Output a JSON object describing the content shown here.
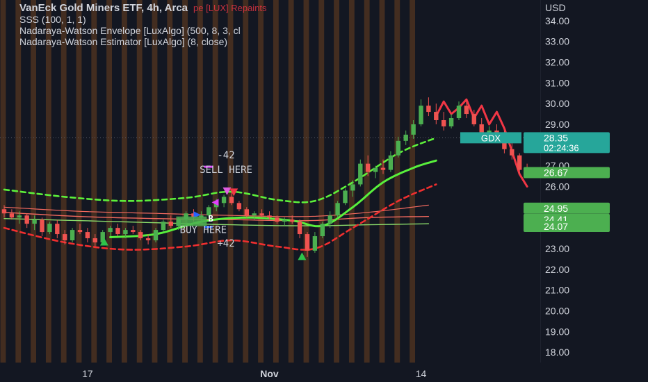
{
  "legend": {
    "title": "VanEck Gold Miners ETF, 4h, Arca",
    "title_suffix": "pe [LUX] Repaints",
    "lines": [
      "SSS (100, 1, 1)",
      "Nadaraya-Watson Envelope [LuxAlgo] (500, 8, 3, cl",
      "Nadaraya-Watson Estimator [LuxAlgo] (8, close)"
    ]
  },
  "colors": {
    "background": "#131722",
    "bar_stripe": "#6b3f1f",
    "up": "#4caf50",
    "down": "#ef5350",
    "envelope_upper": "#5df03a",
    "envelope_lower": "#f02f2f",
    "estimator": "#58f03c",
    "axis_text": "#d1d4dc",
    "price_label": "#26a69a",
    "level_label": "#4caf50"
  },
  "chart_data": {
    "type": "candlestick",
    "currency_label": "USD",
    "ylim": [
      17.5,
      35.0
    ],
    "y_ticks": [
      18,
      19,
      20,
      21,
      22,
      23,
      24,
      25,
      26,
      27,
      28,
      29,
      30,
      31,
      32,
      33,
      34
    ],
    "x_ticks": [
      "17",
      "Nov",
      "14"
    ],
    "ohlc": [
      [
        24.9,
        25.1,
        24.5,
        24.7
      ],
      [
        24.7,
        24.9,
        24.4,
        24.5
      ],
      [
        24.5,
        24.8,
        24.2,
        24.6
      ],
      [
        24.6,
        24.7,
        24.0,
        24.2
      ],
      [
        24.2,
        24.6,
        23.9,
        24.4
      ],
      [
        24.4,
        24.5,
        23.6,
        23.8
      ],
      [
        23.8,
        24.3,
        23.7,
        24.2
      ],
      [
        24.2,
        24.4,
        23.5,
        23.7
      ],
      [
        23.7,
        23.9,
        23.2,
        23.4
      ],
      [
        23.4,
        24.0,
        23.3,
        23.9
      ],
      [
        23.9,
        24.2,
        23.7,
        23.8
      ],
      [
        23.8,
        24.0,
        23.3,
        23.5
      ],
      [
        23.5,
        23.7,
        23.1,
        23.3
      ],
      [
        23.3,
        23.9,
        23.2,
        23.8
      ],
      [
        23.8,
        24.1,
        23.6,
        24.0
      ],
      [
        24.0,
        24.2,
        23.6,
        23.7
      ],
      [
        23.7,
        24.0,
        23.5,
        23.9
      ],
      [
        23.9,
        24.1,
        23.7,
        23.8
      ],
      [
        23.8,
        23.9,
        23.4,
        23.5
      ],
      [
        23.5,
        23.7,
        23.2,
        23.4
      ],
      [
        23.4,
        24.0,
        23.3,
        23.9
      ],
      [
        23.9,
        24.4,
        23.8,
        24.3
      ],
      [
        24.3,
        24.6,
        24.0,
        24.1
      ],
      [
        24.1,
        24.5,
        23.9,
        24.4
      ],
      [
        24.4,
        24.8,
        24.2,
        24.7
      ],
      [
        24.7,
        24.9,
        24.3,
        24.5
      ],
      [
        24.5,
        24.8,
        24.3,
        24.6
      ],
      [
        24.6,
        25.1,
        24.5,
        25.0
      ],
      [
        25.0,
        25.4,
        24.8,
        25.2
      ],
      [
        25.2,
        25.6,
        25.0,
        25.5
      ],
      [
        25.5,
        25.7,
        25.1,
        25.2
      ],
      [
        25.2,
        25.3,
        24.8,
        24.9
      ],
      [
        24.9,
        25.0,
        24.5,
        24.6
      ],
      [
        24.6,
        24.8,
        24.4,
        24.7
      ],
      [
        24.7,
        24.9,
        24.5,
        24.6
      ],
      [
        24.6,
        24.8,
        24.4,
        24.5
      ],
      [
        24.5,
        24.6,
        24.2,
        24.3
      ],
      [
        24.3,
        24.5,
        24.1,
        24.4
      ],
      [
        24.4,
        24.6,
        24.2,
        24.3
      ],
      [
        24.3,
        24.4,
        23.5,
        23.7
      ],
      [
        23.7,
        23.8,
        22.6,
        22.9
      ],
      [
        22.9,
        23.8,
        22.8,
        23.6
      ],
      [
        23.6,
        24.3,
        23.5,
        24.2
      ],
      [
        24.2,
        24.8,
        24.0,
        24.6
      ],
      [
        24.6,
        25.3,
        24.5,
        25.2
      ],
      [
        25.2,
        25.9,
        25.1,
        25.8
      ],
      [
        25.8,
        26.3,
        25.5,
        26.1
      ],
      [
        26.1,
        27.3,
        26.0,
        27.1
      ],
      [
        27.1,
        27.5,
        26.5,
        26.7
      ],
      [
        26.7,
        27.0,
        26.4,
        26.9
      ],
      [
        26.9,
        27.3,
        26.6,
        26.8
      ],
      [
        26.8,
        27.7,
        26.7,
        27.5
      ],
      [
        27.5,
        28.4,
        27.4,
        28.2
      ],
      [
        28.2,
        28.7,
        28.0,
        28.5
      ],
      [
        28.5,
        29.2,
        28.3,
        29.0
      ],
      [
        29.0,
        30.2,
        28.9,
        29.9
      ],
      [
        29.9,
        30.3,
        29.4,
        29.6
      ],
      [
        29.6,
        30.0,
        29.0,
        29.2
      ],
      [
        29.2,
        29.6,
        28.7,
        28.9
      ],
      [
        28.9,
        29.5,
        28.8,
        29.3
      ],
      [
        29.3,
        30.1,
        29.2,
        29.9
      ],
      [
        29.9,
        30.2,
        29.3,
        29.5
      ],
      [
        29.5,
        29.7,
        28.9,
        29.0
      ],
      [
        29.0,
        29.3,
        28.4,
        28.6
      ],
      [
        28.6,
        28.9,
        28.2,
        28.7
      ],
      [
        28.7,
        29.0,
        28.3,
        28.5
      ],
      [
        28.5,
        28.7,
        27.6,
        27.8
      ],
      [
        27.8,
        28.1,
        27.3,
        27.5
      ],
      [
        27.5,
        27.6,
        26.6,
        26.8
      ],
      [
        26.8,
        27.1,
        26.5,
        26.67
      ]
    ],
    "series": [
      {
        "name": "Nadaraya-Watson Envelope upper",
        "type": "dashed",
        "points": [
          [
            0,
            25.85
          ],
          [
            8,
            25.5
          ],
          [
            16,
            25.3
          ],
          [
            24,
            25.45
          ],
          [
            30,
            25.75
          ],
          [
            36,
            25.35
          ],
          [
            41,
            25.3
          ],
          [
            46,
            26.2
          ],
          [
            52,
            27.6
          ],
          [
            57,
            28.35
          ]
        ]
      },
      {
        "name": "Nadaraya-Watson Envelope lower",
        "type": "dashed",
        "points": [
          [
            0,
            24.0
          ],
          [
            8,
            23.3
          ],
          [
            16,
            22.95
          ],
          [
            24,
            23.1
          ],
          [
            30,
            23.4
          ],
          [
            36,
            23.1
          ],
          [
            41,
            23.0
          ],
          [
            46,
            24.0
          ],
          [
            52,
            25.3
          ],
          [
            57,
            26.1
          ]
        ]
      },
      {
        "name": "Nadaraya-Watson Estimator",
        "type": "solid",
        "points": [
          [
            14,
            23.55
          ],
          [
            20,
            23.7
          ],
          [
            26,
            24.3
          ],
          [
            32,
            24.5
          ],
          [
            38,
            24.35
          ],
          [
            42,
            24.1
          ],
          [
            46,
            25.0
          ],
          [
            50,
            26.2
          ],
          [
            54,
            26.9
          ],
          [
            57,
            27.25
          ]
        ]
      },
      {
        "name": "Nadaraya-Watson Estimator (repaint)",
        "type": "solid",
        "points": [
          [
            57,
            29.4
          ],
          [
            58,
            30.1
          ],
          [
            59,
            29.5
          ],
          [
            60,
            29.8
          ],
          [
            61,
            30.2
          ],
          [
            62,
            29.3
          ],
          [
            63,
            29.9
          ],
          [
            64,
            29.0
          ],
          [
            65,
            29.6
          ],
          [
            66,
            28.8
          ],
          [
            67,
            27.7
          ],
          [
            68,
            26.6
          ],
          [
            69,
            26.0
          ]
        ]
      },
      {
        "name": "SSS mid",
        "type": "solid",
        "points": [
          [
            0,
            24.75
          ],
          [
            10,
            24.55
          ],
          [
            20,
            24.45
          ],
          [
            30,
            24.4
          ],
          [
            40,
            24.35
          ],
          [
            48,
            24.5
          ],
          [
            56,
            24.55
          ]
        ]
      },
      {
        "name": "SSS low",
        "type": "solid",
        "points": [
          [
            0,
            24.45
          ],
          [
            10,
            24.35
          ],
          [
            20,
            24.25
          ],
          [
            30,
            24.15
          ],
          [
            40,
            24.1
          ],
          [
            48,
            24.15
          ],
          [
            56,
            24.2
          ]
        ]
      },
      {
        "name": "SSS high",
        "type": "solid",
        "points": [
          [
            0,
            25.0
          ],
          [
            10,
            24.8
          ],
          [
            20,
            24.7
          ],
          [
            30,
            24.6
          ],
          [
            40,
            24.55
          ],
          [
            48,
            24.75
          ],
          [
            56,
            25.1
          ]
        ]
      }
    ],
    "annotations": [
      {
        "text": "-42",
        "index": 30,
        "y": 27.35
      },
      {
        "text": "SELL HERE",
        "index": 30,
        "y": 26.65
      },
      {
        "text": "BUY HERE",
        "index": 27,
        "y": 23.75
      },
      {
        "text": "+42",
        "index": 30,
        "y": 23.1
      },
      {
        "text": "B",
        "index": 28,
        "y": 24.3
      }
    ],
    "price_labels": [
      {
        "text": "28.35",
        "sub": "02:24:36",
        "y": 28.35,
        "color": "#26a69a"
      },
      {
        "text": "26.67",
        "y": 26.67,
        "color": "#4caf50"
      },
      {
        "text": "24.95",
        "y": 24.95,
        "color": "#4caf50"
      },
      {
        "text": "24.41",
        "y": 24.41,
        "color": "#4caf50"
      },
      {
        "text": "24.07",
        "y": 24.07,
        "color": "#4caf50"
      }
    ],
    "symbol_tag": {
      "text": "GDX",
      "y": 28.35
    }
  }
}
